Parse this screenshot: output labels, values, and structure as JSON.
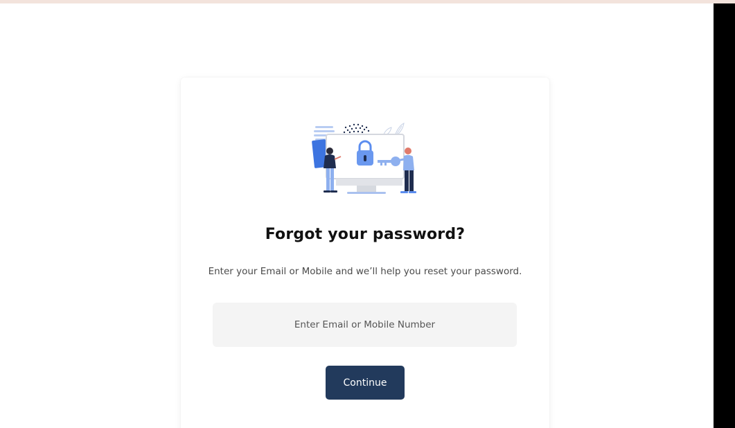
{
  "reset": {
    "title": "Forgot your password?",
    "subtitle": "Enter your Email or Mobile and we’ll help you reset your password.",
    "input_placeholder": "Enter Email or Mobile Number",
    "input_value": "",
    "button_label": "Continue"
  },
  "illustration": {
    "icon": "lock-icon",
    "depicts": [
      "monitor-icon",
      "lock-icon",
      "key-icon",
      "person-icon"
    ]
  },
  "colors": {
    "button_bg": "#223a5c",
    "input_bg": "#f4f4f4",
    "accent_blue": "#5b8def",
    "top_strip": "#f3e3dc"
  }
}
